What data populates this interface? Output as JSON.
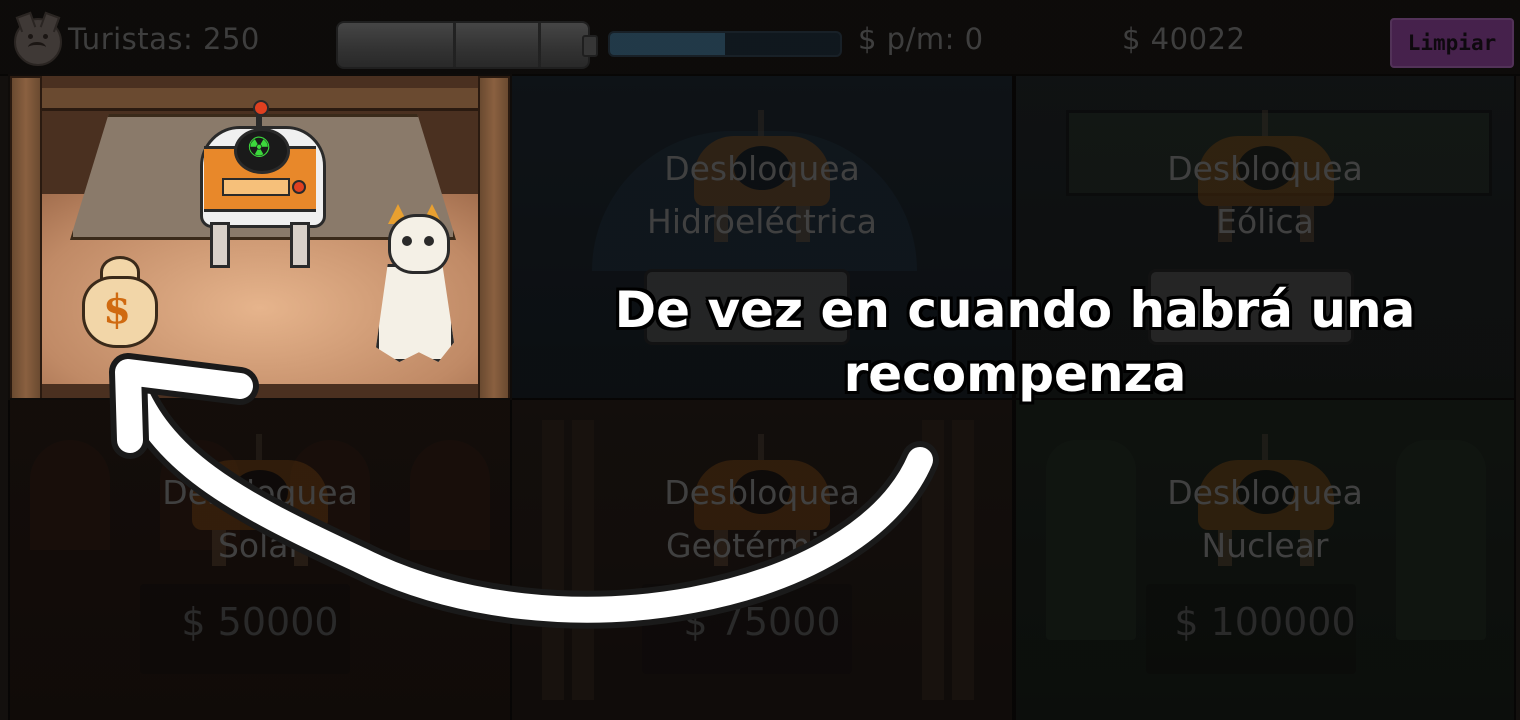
{
  "hud": {
    "tourists_label": "Turistas: 250",
    "income_label": "$ p/m: 0",
    "money_label": "$ 40022",
    "clean_button": "Limpiar",
    "progress": 0.5,
    "mood_icon": "sad-cat-face-icon"
  },
  "rooms": {
    "hydro": {
      "line1": "Desbloquea",
      "line2": "Hidroeléctrica"
    },
    "wind": {
      "line1": "Desbloquea",
      "line2": "Eólica"
    },
    "solar": {
      "line1": "Desbloquea",
      "line2": "Solar",
      "price": "$ 50000"
    },
    "geo": {
      "line1": "Desbloquea",
      "line2": "Geotérmica",
      "price": "$ 75000"
    },
    "nuclear": {
      "line1": "Desbloquea",
      "line2": "Nuclear",
      "price": "$ 100000"
    }
  },
  "active_room": {
    "machine_icon": "radiation-icon",
    "reward_icon": "money-bag-icon",
    "reward_symbol": "$"
  },
  "tutorial": {
    "caption": "De vez en cuando habrá una recompenza"
  },
  "colors": {
    "clean_button": "#9b4aa8",
    "progress_fill": "#4a7fa0",
    "caption_text": "#ffffff"
  }
}
